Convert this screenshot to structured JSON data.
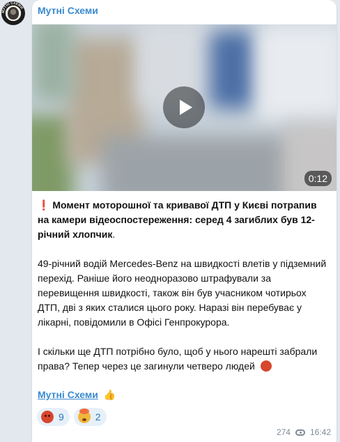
{
  "channel": {
    "name": "Мутні Схеми",
    "avatar_text": "МУТНІ СХЕМИ"
  },
  "video": {
    "duration": "0:12"
  },
  "post": {
    "lead_prefix": "❗",
    "lead_text": "Момент моторошної та кривавої ДТП у Києві потрапив на камери відеоспостереження: серед 4 загиблих був 12-річний хлопчик",
    "lead_end": ".",
    "paragraph_2": "49-річний водій Mercedes-Benz на швидкості влетів у підземний перехід. Раніше його неодноразово штрафували за перевищення швидкості, також він був учасником чотирьох ДТП, дві з яких сталися цього року. Наразі він перебуває у лікарні, повідомили в Офісі Генпрокурора.",
    "paragraph_3": "І скільки ще ДТП потрібно було, щоб у нього нарешті забрали права? Тепер через це загинули четверо людей",
    "signature_link": "Мутні Схеми",
    "signature_emoji": "👍"
  },
  "reactions": [
    {
      "emoji": "angry-face-icon",
      "count": "9"
    },
    {
      "emoji": "mind-blown-icon",
      "count": "2"
    }
  ],
  "meta": {
    "views": "274",
    "time": "16:42"
  },
  "colors": {
    "accent": "#3a8ad0",
    "background": "#e2e8ee",
    "bubble": "#ffffff"
  }
}
